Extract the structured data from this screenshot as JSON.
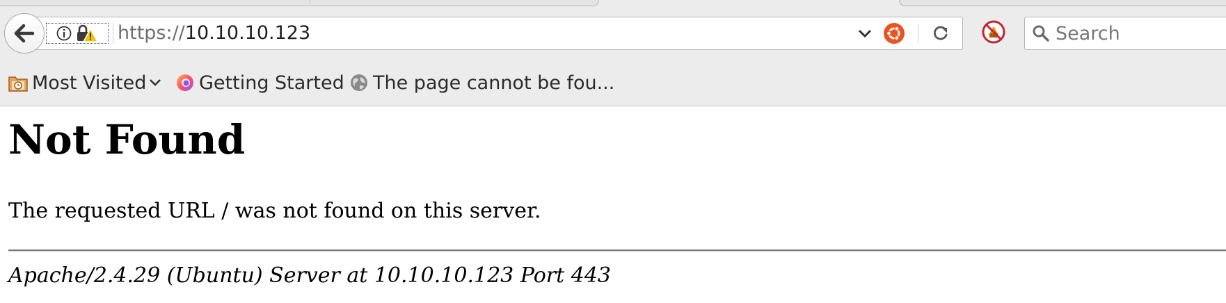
{
  "toolbar": {
    "url_scheme": "https://",
    "url_host": "10.10.10.123",
    "search_placeholder": "Search"
  },
  "bookmarks": [
    {
      "label": "Most Visited",
      "icon": "folder-clock-icon"
    },
    {
      "label": "Getting Started",
      "icon": "firefox-icon"
    },
    {
      "label": "The page cannot be fou...",
      "icon": "globe-icon"
    }
  ],
  "page": {
    "heading": "Not Found",
    "message": "The requested URL / was not found on this server.",
    "signature": "Apache/2.4.29 (Ubuntu) Server at 10.10.10.123 Port 443"
  },
  "colors": {
    "chrome_bg": "#ececec",
    "ubuntu_orange": "#e95420",
    "warning_yellow": "#f5c400"
  }
}
